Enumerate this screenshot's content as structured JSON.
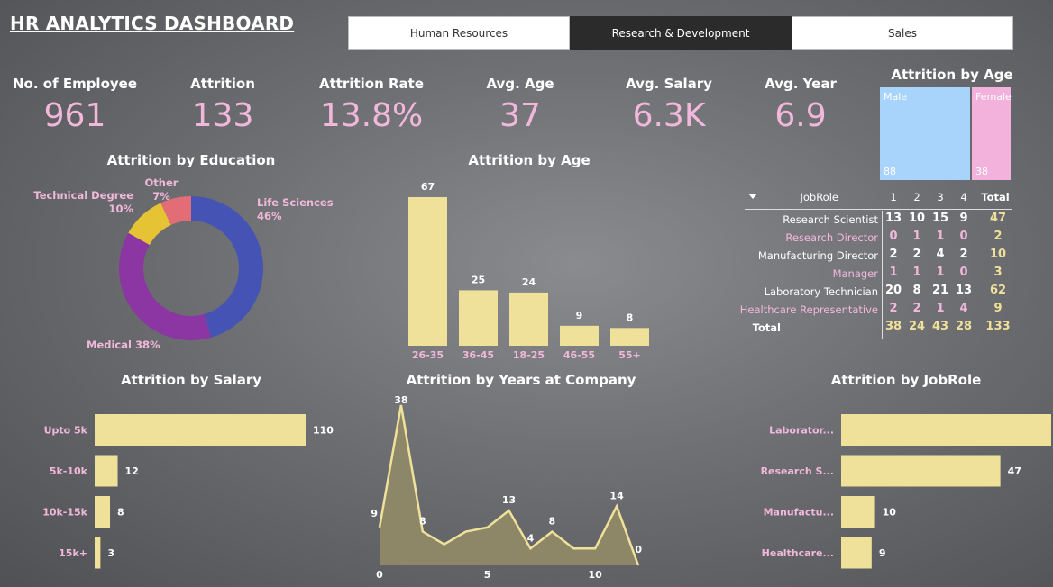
{
  "header": {
    "title": "HR ANALYTICS DASHBOARD"
  },
  "tabs": [
    {
      "label": "Human Resources",
      "active": false
    },
    {
      "label": "Research & Development",
      "active": true
    },
    {
      "label": "Sales",
      "active": false
    }
  ],
  "kpis": [
    {
      "label": "No. of Employee",
      "value": "961"
    },
    {
      "label": "Attrition",
      "value": "133"
    },
    {
      "label": "Attrition Rate",
      "value": "13.8%"
    },
    {
      "label": "Avg. Age",
      "value": "37"
    },
    {
      "label": "Avg. Salary",
      "value": "6.3K"
    },
    {
      "label": "Avg. Year",
      "value": "6.9"
    }
  ],
  "colors": {
    "bar": "#efe19a",
    "pink": "#f2b8dc",
    "male": "#a8d3fb",
    "female": "#f2b2dc",
    "life": "#4553b5",
    "medical": "#8b36a3",
    "technical": "#e6c235",
    "other": "#e26d76"
  },
  "treemap": {
    "title": "Attrition by Age",
    "male_label": "Male",
    "male_value": "88",
    "female_label": "Female",
    "female_value": "38"
  },
  "jobtable": {
    "header": {
      "role": "JobRole",
      "cols": [
        "1",
        "2",
        "3",
        "4"
      ],
      "total": "Total"
    },
    "rows": [
      {
        "role": "Research Scientist",
        "vals": [
          "13",
          "10",
          "15",
          "9"
        ],
        "total": "47",
        "style": "white"
      },
      {
        "role": "Research Director",
        "vals": [
          "0",
          "1",
          "1",
          "0"
        ],
        "total": "2",
        "style": "pink"
      },
      {
        "role": "Manufacturing Director",
        "vals": [
          "2",
          "2",
          "4",
          "2"
        ],
        "total": "10",
        "style": "white"
      },
      {
        "role": "Manager",
        "vals": [
          "1",
          "1",
          "1",
          "0"
        ],
        "total": "3",
        "style": "pink"
      },
      {
        "role": "Laboratory Technician",
        "vals": [
          "20",
          "8",
          "21",
          "13"
        ],
        "total": "62",
        "style": "white"
      },
      {
        "role": "Healthcare Representative",
        "vals": [
          "2",
          "2",
          "1",
          "4"
        ],
        "total": "9",
        "style": "pink"
      }
    ],
    "total_row": {
      "role": "Total",
      "vals": [
        "38",
        "24",
        "43",
        "28"
      ],
      "total": "133"
    }
  },
  "chart_data": [
    {
      "type": "pie",
      "title": "Attrition by Education",
      "donut": true,
      "slices": [
        {
          "label": "Life Sciences",
          "pct": "46%",
          "value": 46
        },
        {
          "label": "Medical",
          "pct": "38%",
          "value": 38
        },
        {
          "label": "Technical Degree",
          "pct": "10%",
          "value": 10
        },
        {
          "label": "Other",
          "pct": "7%",
          "value": 7
        }
      ]
    },
    {
      "type": "bar",
      "title": "Attrition by Age",
      "categories": [
        "26-35",
        "36-45",
        "18-25",
        "46-55",
        "55+"
      ],
      "values": [
        67,
        25,
        24,
        9,
        8
      ]
    },
    {
      "type": "bar",
      "orientation": "horizontal",
      "title": "Attrition by Salary",
      "categories": [
        "Upto 5k",
        "5k-10k",
        "10k-15k",
        "15k+"
      ],
      "values": [
        110,
        12,
        8,
        3
      ]
    },
    {
      "type": "area",
      "title": "Attrition by Years at Company",
      "x": [
        0,
        1,
        2,
        3,
        4,
        5,
        6,
        7,
        8,
        9,
        10,
        11
      ],
      "values": [
        9,
        38,
        8,
        5,
        8,
        9,
        13,
        4,
        8,
        4,
        4,
        14,
        0
      ],
      "x_tick_labels": [
        "0",
        "5",
        "10"
      ],
      "point_labels": [
        "9",
        "38",
        "8",
        "13",
        "4",
        "8",
        "14",
        "0"
      ]
    },
    {
      "type": "bar",
      "orientation": "horizontal",
      "title": "Attrition by JobRole",
      "categories": [
        "Laborator...",
        "Research S...",
        "Manufactu...",
        "Healthcare..."
      ],
      "values": [
        62,
        47,
        10,
        9
      ]
    }
  ]
}
